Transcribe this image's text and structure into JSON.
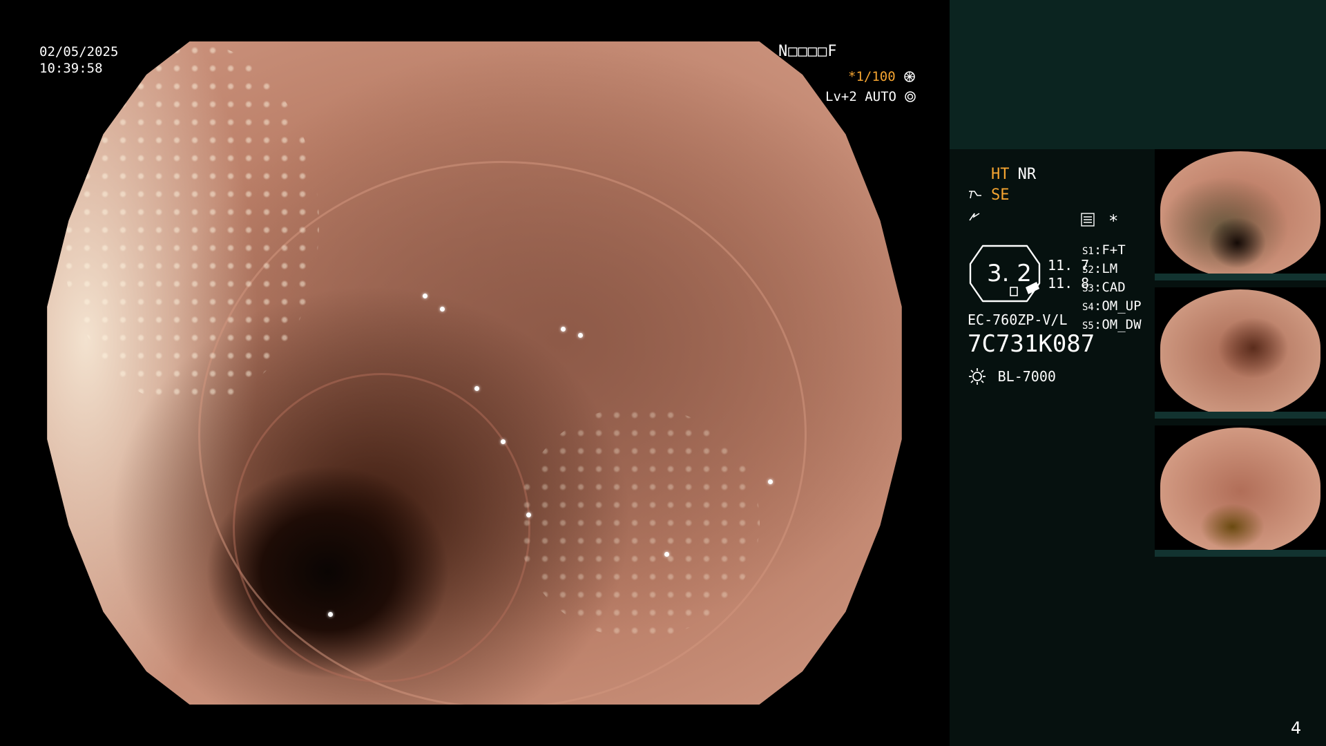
{
  "overlay": {
    "date": "02/05/2025",
    "time": "10:39:58",
    "code": "N□□□□F",
    "shutter": "*1/100",
    "level": "Lv+2 AUTO"
  },
  "panel": {
    "ht": "HT",
    "nr": "NR",
    "se": "SE",
    "gauge_value": "3. 2",
    "val1": "11. 7",
    "val2": "11. 8",
    "scope_model": "EC-760ZP-V/L",
    "serial": "7C731K087",
    "light_source": "BL-7000",
    "settings": [
      {
        "key": "S1",
        "value": "F+T"
      },
      {
        "key": "S2",
        "value": "LM"
      },
      {
        "key": "S3",
        "value": "CAD"
      },
      {
        "key": "S4",
        "value": "OM_UP"
      },
      {
        "key": "S5",
        "value": "OM_DW"
      }
    ],
    "page_number": "4"
  },
  "colors": {
    "panel_bg": "#06110f",
    "top_block": "#0b2420",
    "accent_orange": "#f6a531"
  },
  "icons": [
    "shutter-icon",
    "auto-icon",
    "scope-icon",
    "flash-icon",
    "menu-icon",
    "light-icon"
  ]
}
